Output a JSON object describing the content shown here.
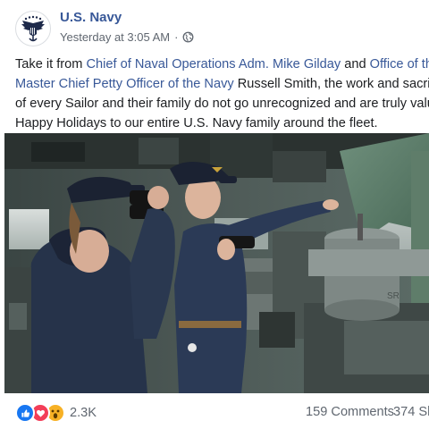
{
  "post": {
    "page_name": "U.S. Navy",
    "timestamp": "Yesterday at 3:05 AM",
    "separator": "·",
    "visibility_icon": "globe-icon",
    "avatar_icon": "navy-eagle-emblem-icon",
    "text": {
      "line1_prefix": "Take it from ",
      "line1_link1": "Chief of Naval Operations Adm. Mike Gilday",
      "line1_mid": " and ",
      "line1_link2": "Office of the",
      "line2_link": "Master Chief Petty Officer of the Navy",
      "line2_rest": " Russell Smith, the work and sacrif",
      "line3": "of every Sailor and their family do not go unrecognized and are truly valu",
      "line4": "Happy Holidays to our entire U.S. Navy family around the fleet."
    },
    "photo": {
      "description_icon": "photo-sailors-on-bridge"
    }
  },
  "footer": {
    "reaction_icons": [
      "like-icon",
      "love-icon",
      "wow-icon"
    ],
    "reaction_count": "2.3K",
    "comments": "159 Comments",
    "shares": "374 Sh"
  },
  "colors": {
    "link": "#385898",
    "text": "#1c1e21",
    "meta": "#606770",
    "like": "#1877f2",
    "love": "#f33e58",
    "wow": "#f7b125"
  }
}
